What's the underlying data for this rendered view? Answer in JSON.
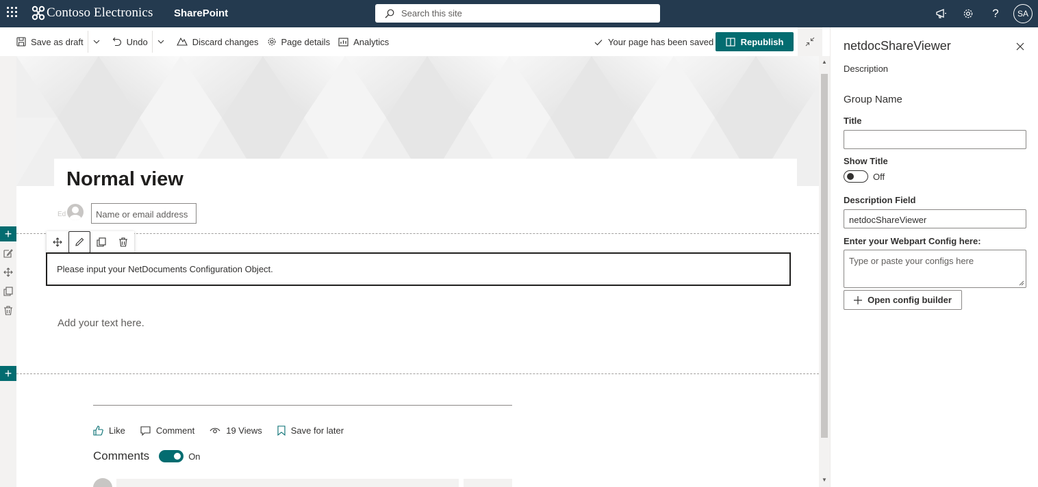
{
  "suite": {
    "brand": "Contoso Electronics",
    "app": "SharePoint",
    "search_placeholder": "Search this site",
    "avatar_initials": "SA"
  },
  "commands": {
    "save_draft": "Save as draft",
    "undo": "Undo",
    "discard": "Discard changes",
    "page_details": "Page details",
    "analytics": "Analytics",
    "saved_status": "Your page has been saved",
    "republish": "Republish"
  },
  "page": {
    "title": "Normal view",
    "author_ghost": "Ed",
    "name_placeholder": "Name or email address",
    "webpart_message": "Please input your NetDocuments Configuration Object.",
    "add_text": "Add your text here."
  },
  "social": {
    "like": "Like",
    "comment": "Comment",
    "views": "19 Views",
    "save_for_later": "Save for later",
    "comments_label": "Comments",
    "comments_state": "On"
  },
  "pane": {
    "title": "netdocShareViewer",
    "description": "Description",
    "group_name": "Group Name",
    "title_label": "Title",
    "title_value": "",
    "show_title_label": "Show Title",
    "show_title_state": "Off",
    "description_field_label": "Description Field",
    "description_field_value": "netdocShareViewer",
    "config_label": "Enter your Webpart Config here:",
    "config_placeholder": "Type or paste your configs here",
    "config_builder": "Open config builder"
  },
  "colors": {
    "suite_bar": "#243a4f",
    "accent": "#036c70"
  }
}
